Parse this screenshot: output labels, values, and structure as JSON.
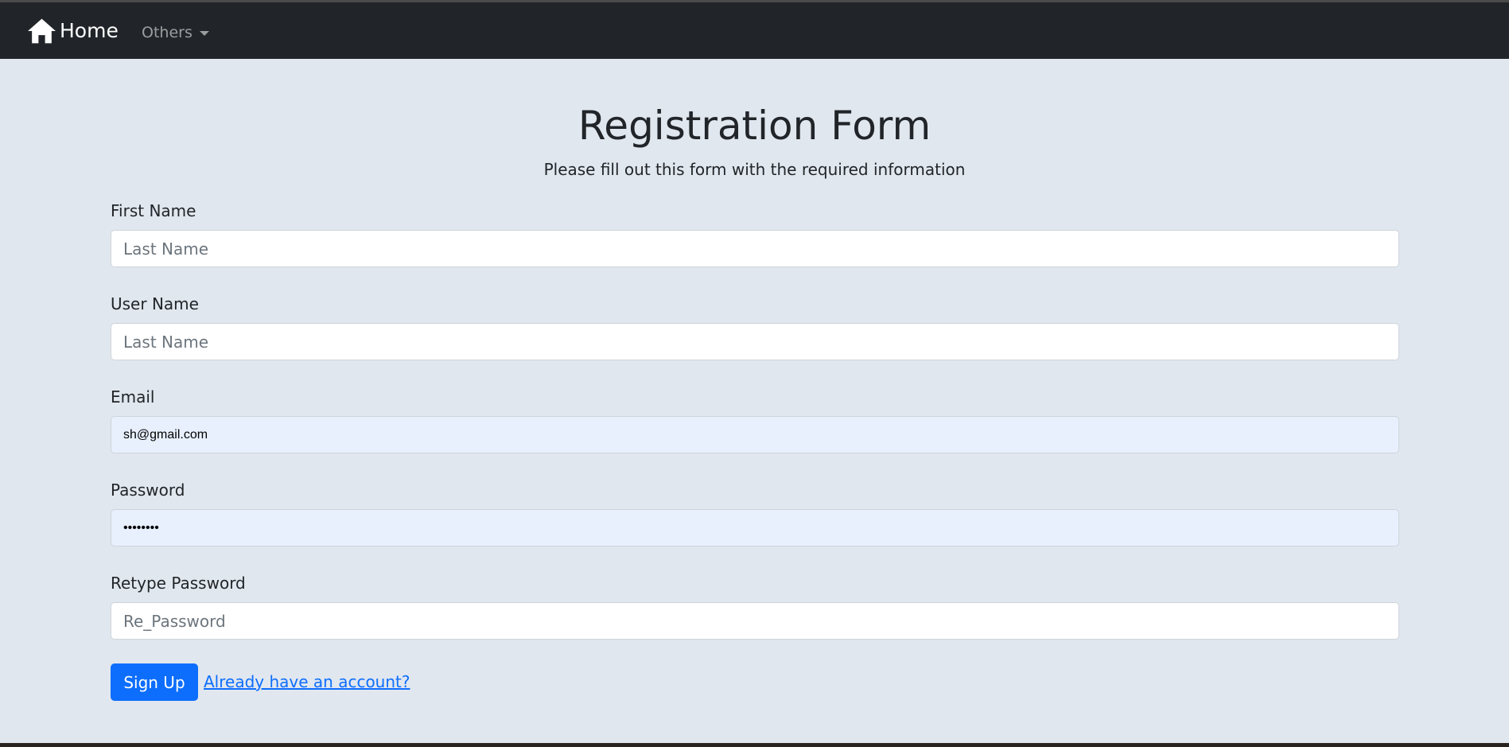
{
  "navbar": {
    "brand_icon": "home-icon",
    "brand_label": "Home",
    "dropdown_label": "Others"
  },
  "page": {
    "title": "Registration Form",
    "subtitle": "Please fill out this form with the required information"
  },
  "form": {
    "first_name": {
      "label": "First Name",
      "placeholder": "Last Name",
      "value": ""
    },
    "user_name": {
      "label": "User Name",
      "placeholder": "Last Name",
      "value": ""
    },
    "email": {
      "label": "Email",
      "placeholder": "",
      "value": "sh@gmail.com"
    },
    "password": {
      "label": "Password",
      "placeholder": "",
      "value": "12345678"
    },
    "retype_password": {
      "label": "Retype Password",
      "placeholder": "Re_Password",
      "value": ""
    },
    "submit_label": "Sign Up",
    "login_link_label": "Already have an account?"
  },
  "colors": {
    "navbar_bg": "#212529",
    "page_bg": "#e1e7ef",
    "primary": "#0d6efd",
    "autofill_bg": "#e8f0fe"
  }
}
